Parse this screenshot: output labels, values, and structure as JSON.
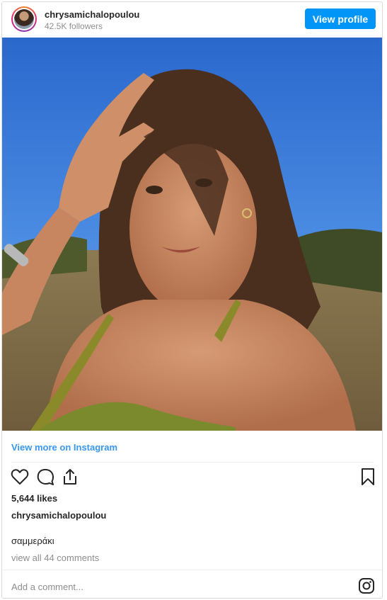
{
  "header": {
    "username": "chrysamichalopoulou",
    "followers": "42.5K followers",
    "view_profile_label": "View profile"
  },
  "post": {
    "view_more_label": "View more on Instagram",
    "likes": "5,644 likes",
    "caption_user": "chrysamichalopoulou",
    "caption_text": "σαμμεράκι",
    "view_comments": "view all 44 comments"
  },
  "comment": {
    "placeholder": "Add a comment..."
  },
  "icons": {
    "like": "heart-icon",
    "comment": "comment-icon",
    "share": "share-icon",
    "save": "bookmark-icon",
    "instagram": "instagram-icon"
  },
  "colors": {
    "accent": "#0095f6",
    "link": "#3897f0",
    "text": "#262626",
    "muted": "#8e8e8e"
  }
}
